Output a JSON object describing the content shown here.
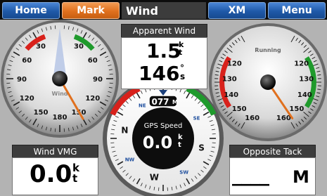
{
  "topbar": {
    "home_label": "Home",
    "mark_label": "Mark",
    "page_title": "Wind",
    "xm_label": "XM",
    "menu_label": "Menu"
  },
  "wind_gauge": {
    "label": "Wind",
    "scale_labels_left": [
      "30",
      "60",
      "90",
      "120",
      "150",
      "180"
    ],
    "scale_labels_right": [
      "30",
      "60",
      "90",
      "120",
      "150"
    ],
    "needle_angle_deg": 150
  },
  "apparent_wind": {
    "label": "Apparent Wind",
    "speed_value": "1.5",
    "speed_unit": "kt",
    "angle_value": "146",
    "angle_unit": "°s"
  },
  "compass": {
    "heading": "077",
    "heading_unit": "M",
    "label": "GPS Speed",
    "value": "0.0",
    "unit": "kt",
    "cardinal": [
      "N",
      "NE",
      "E",
      "SE",
      "S",
      "SW",
      "W",
      "NW"
    ]
  },
  "running_gauge": {
    "label": "Running",
    "scale_left": [
      "120",
      "130",
      "140",
      "150",
      "160"
    ],
    "scale_right": [
      "120",
      "130",
      "140",
      "150",
      "160"
    ],
    "needle_angle_deg": 146
  },
  "wind_vmg": {
    "label": "Wind VMG",
    "value": "0.0",
    "unit": "kt"
  },
  "opposite_tack": {
    "label": "Opposite Tack",
    "value": "____",
    "unit": "M"
  },
  "colors": {
    "accent_blue": "#2561b0",
    "mark_orange": "#e0701e",
    "port_red": "#d8211b",
    "starboard_green": "#1f9a2c"
  }
}
